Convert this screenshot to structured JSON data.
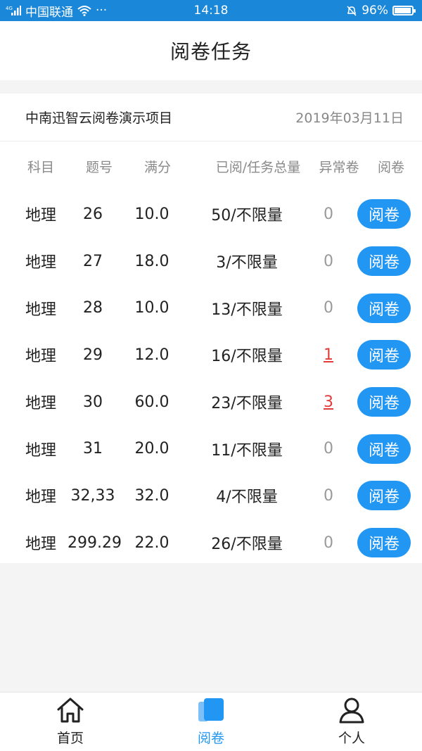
{
  "status": {
    "carrier": "中国联通",
    "time": "14:18",
    "battery": "96%",
    "network": "4G"
  },
  "header": {
    "title": "阅卷任务"
  },
  "project": {
    "name": "中南迅智云阅卷演示项目",
    "date": "2019年03月11日"
  },
  "table": {
    "headers": {
      "subject": "科目",
      "qno": "题号",
      "score": "满分",
      "progress": "已阅/任务总量",
      "abnormal": "异常卷",
      "action": "阅卷"
    },
    "rows": [
      {
        "subject": "地理",
        "qno": "26",
        "score": "10.0",
        "progress": "50/不限量",
        "abnormal": "0",
        "action": "阅卷"
      },
      {
        "subject": "地理",
        "qno": "27",
        "score": "18.0",
        "progress": "3/不限量",
        "abnormal": "0",
        "action": "阅卷"
      },
      {
        "subject": "地理",
        "qno": "28",
        "score": "10.0",
        "progress": "13/不限量",
        "abnormal": "0",
        "action": "阅卷"
      },
      {
        "subject": "地理",
        "qno": "29",
        "score": "12.0",
        "progress": "16/不限量",
        "abnormal": "1",
        "action": "阅卷"
      },
      {
        "subject": "地理",
        "qno": "30",
        "score": "60.0",
        "progress": "23/不限量",
        "abnormal": "3",
        "action": "阅卷"
      },
      {
        "subject": "地理",
        "qno": "31",
        "score": "20.0",
        "progress": "11/不限量",
        "abnormal": "0",
        "action": "阅卷"
      },
      {
        "subject": "地理",
        "qno": "32,33",
        "score": "32.0",
        "progress": "4/不限量",
        "abnormal": "0",
        "action": "阅卷"
      },
      {
        "subject": "地理",
        "qno": "299.29",
        "score": "22.0",
        "progress": "26/不限量",
        "abnormal": "0",
        "action": "阅卷"
      }
    ]
  },
  "tabs": [
    {
      "label": "首页",
      "icon": "home-icon",
      "active": false
    },
    {
      "label": "阅卷",
      "icon": "papers-icon",
      "active": true
    },
    {
      "label": "个人",
      "icon": "person-icon",
      "active": false
    }
  ],
  "colors": {
    "accent": "#2196f3",
    "statusbar": "#1b87d8",
    "alert": "#e23b3b"
  }
}
